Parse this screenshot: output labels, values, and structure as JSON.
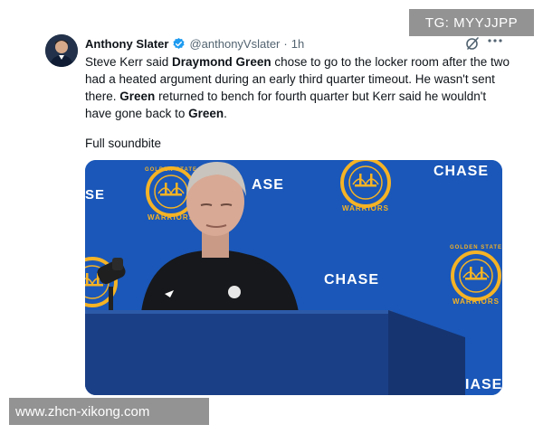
{
  "watermarks": {
    "top": "TG: MYYJJPP",
    "bottom": "www.zhcn-xikong.com"
  },
  "tweet": {
    "author_name": "Anthony Slater",
    "handle": "@anthonyVslater",
    "separator": "·",
    "time": "1h",
    "verified": true,
    "text_segments": [
      {
        "text": "Steve Kerr said ",
        "bold": false
      },
      {
        "text": "Draymond Green",
        "bold": true
      },
      {
        "text": " chose to go to the locker room after the two had a heated argument during an early third quarter timeout. He wasn't sent there. ",
        "bold": false
      },
      {
        "text": "Green",
        "bold": true
      },
      {
        "text": " returned to bench for fourth quarter but Kerr said he wouldn't have gone back to ",
        "bold": false
      },
      {
        "text": "Green",
        "bold": true
      },
      {
        "text": ".",
        "bold": false
      }
    ],
    "soundbite_label": "Full soundbite"
  },
  "media": {
    "backdrop_text": [
      "CHASE",
      "SE",
      "ASE",
      "CHASE",
      "IASE"
    ],
    "logo_text": "WARRIORS",
    "logo_top_text": "GOLDEN STATE"
  },
  "colors": {
    "verified_blue": "#1d9bf0",
    "backdrop_blue": "#1a57b8",
    "warriors_gold": "#f5b325",
    "podium": "#1b3f86",
    "text_secondary": "#536471"
  },
  "icons": {
    "verified": "verified-badge-icon",
    "grok": "grok-icon",
    "more": "more-options-icon"
  }
}
